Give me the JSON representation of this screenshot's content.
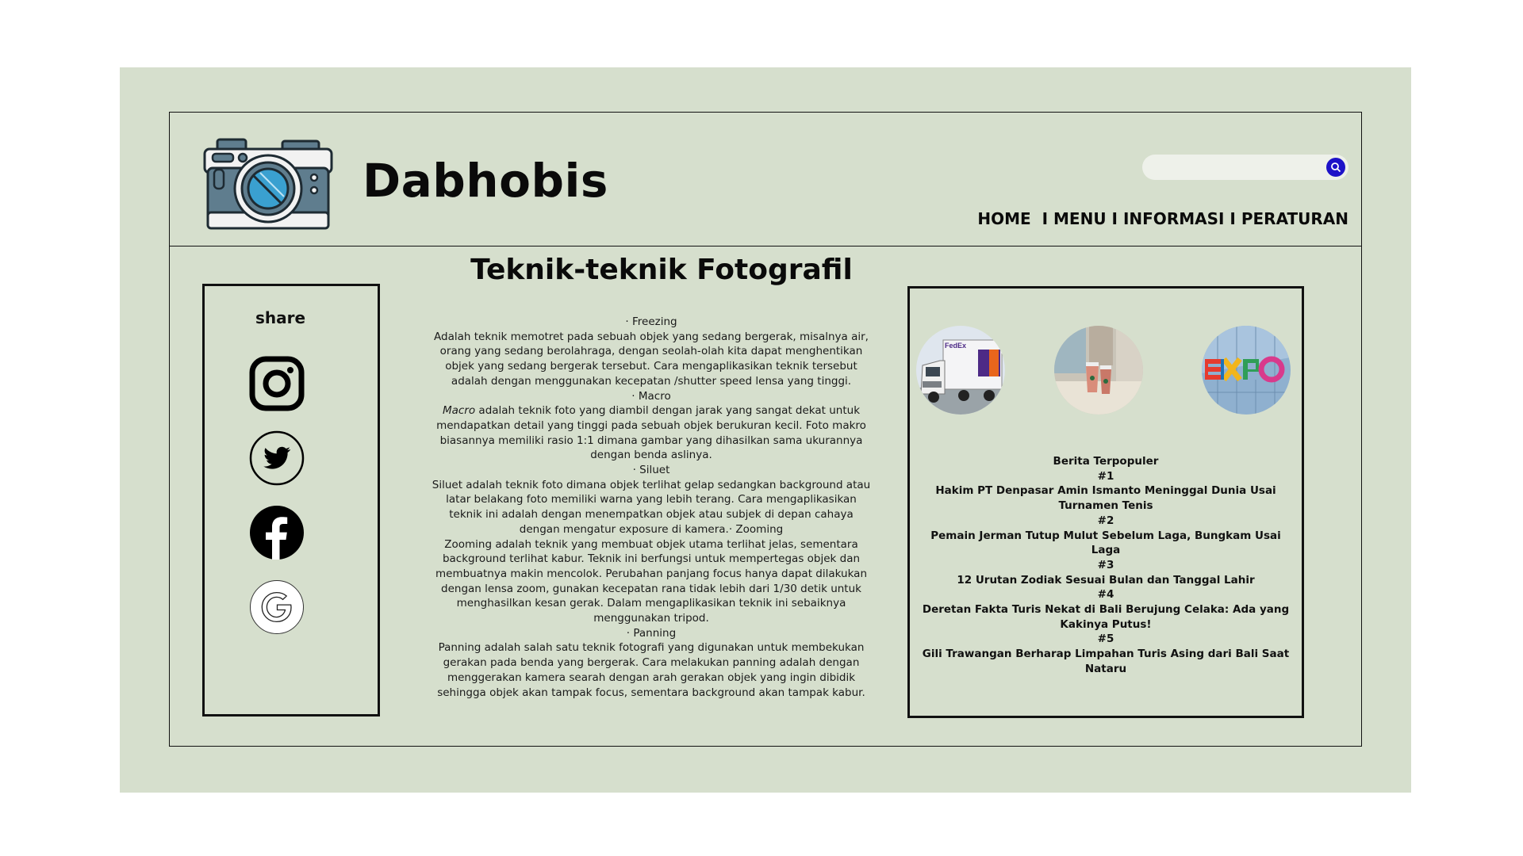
{
  "brand": {
    "name": "Dabhobis",
    "logo_icon": "camera-icon"
  },
  "search": {
    "placeholder": "",
    "icon": "search-icon",
    "accent": "#1d12c8"
  },
  "nav": {
    "items": [
      "HOME",
      "MENU",
      "INFORMASI",
      "PERATURAN"
    ],
    "separator": "I"
  },
  "share": {
    "label": "share",
    "icons": [
      "instagram-icon",
      "twitter-icon",
      "facebook-icon",
      "google-icon"
    ]
  },
  "article": {
    "title": "Teknik-teknik Fotografil",
    "sections": [
      "· Freezing",
      "Adalah teknik memotret pada sebuah objek yang sedang bergerak, misalnya air, orang yang sedang berolahraga, dengan seolah-olah kita dapat menghentikan objek yang sedang bergerak tersebut. Cara mengaplikasikan teknik tersebut adalah dengan menggunakan kecepatan /shutter speed lensa yang tinggi.",
      "· Macro",
      "adalah teknik foto yang diambil dengan jarak yang sangat dekat untuk mendapatkan detail yang tinggi pada sebuah objek berukuran kecil. Foto makro biasannya memiliki rasio 1:1 dimana gambar yang dihasilkan sama ukurannya dengan benda aslinya.",
      "· Siluet",
      "Siluet adalah teknik foto dimana objek terlihat gelap sedangkan background atau latar belakang foto memiliki warna yang lebih terang. Cara mengaplikasikan teknik ini adalah dengan menempatkan objek atau subjek di depan cahaya dengan mengatur exposure di kamera.· Zooming",
      "Zooming adalah teknik yang membuat objek utama terlihat jelas, sementara background terlihat kabur. Teknik ini berfungsi untuk mempertegas objek dan membuatnya makin mencolok. Perubahan panjang focus hanya dapat dilakukan dengan lensa zoom, gunakan kecepatan rana tidak lebih dari 1/30 detik untuk menghasilkan kesan gerak. Dalam mengaplikasikan teknik ini sebaiknya menggunakan tripod.",
      "· Panning",
      "Panning adalah salah satu teknik fotografi yang digunakan untuk membekukan gerakan pada benda yang bergerak. Cara melakukan panning adalah dengan menggerakan kamera searah dengan arah gerakan objek yang ingin dibidik sehingga objek akan tampak focus, sementara background akan tampak kabur."
    ],
    "macro_word": "Macro"
  },
  "popular": {
    "thumbnails": [
      "fedex-truck-photo",
      "drinks-photo",
      "expo-photo"
    ],
    "heading": "Berita Terpopuler",
    "items": [
      {
        "rank": "#1",
        "title": "Hakim PT Denpasar Amin Ismanto Meninggal Dunia Usai Turnamen Tenis"
      },
      {
        "rank": "#2",
        "title": "Pemain Jerman Tutup Mulut Sebelum Laga, Bungkam Usai Laga"
      },
      {
        "rank": "#3",
        "title": "12 Urutan Zodiak Sesuai Bulan dan Tanggal Lahir"
      },
      {
        "rank": "#4",
        "title": "Deretan Fakta Turis Nekat di Bali Berujung Celaka: Ada yang Kakinya Putus!"
      },
      {
        "rank": "#5",
        "title": "Gili Trawangan Berharap Limpahan Turis Asing dari Bali Saat Nataru"
      }
    ]
  },
  "colors": {
    "background": "#d6dfcd",
    "border": "#111111",
    "camera_body": "#5f7d8e",
    "camera_lens": "#3aa0d0"
  }
}
